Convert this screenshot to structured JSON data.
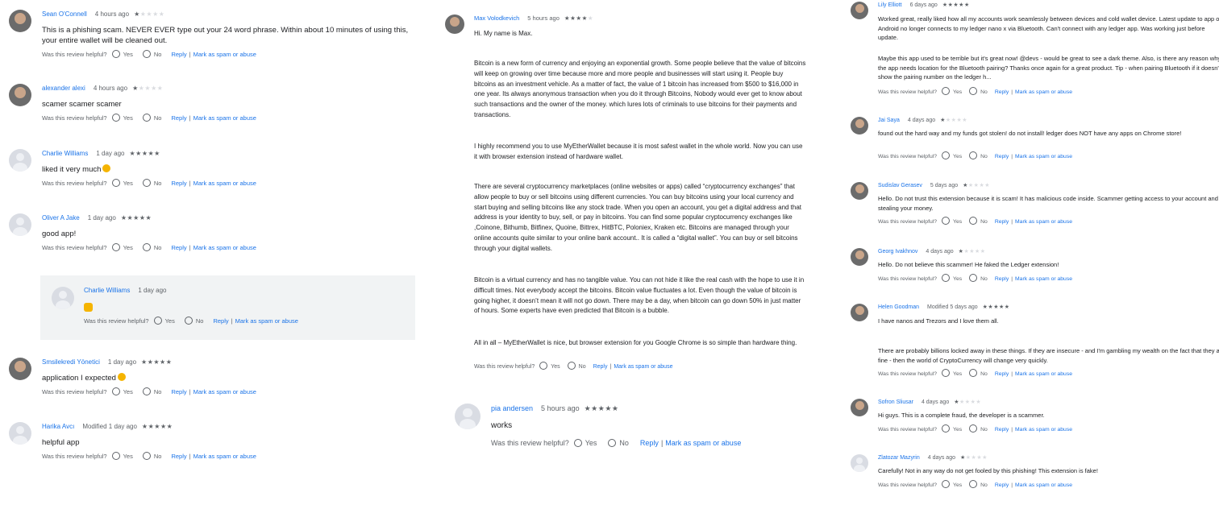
{
  "ui": {
    "helpful_q": "Was this review helpful?",
    "yes": "Yes",
    "no": "No",
    "reply": "Reply",
    "sep": "|",
    "spam": "Mark as spam or abuse"
  },
  "colors": {
    "link": "#1a73e8",
    "star_on": "#5f6368",
    "star_off": "#dadce0",
    "reply_bg": "#f1f3f4"
  },
  "col1": [
    {
      "author": "Sean O'Connell",
      "date": "4 hours ago",
      "rating": 1,
      "text": "This is a phishing scam. NEVER EVER type out your 24 word phrase. Within about 10 minutes of using this, your entire wallet will be cleaned out."
    },
    {
      "author": "alexander alexi",
      "date": "4 hours ago",
      "rating": 1,
      "text": "scamer scamer scamer"
    },
    {
      "author": "Charlie Williams",
      "date": "1 day ago",
      "rating": 5,
      "text": "liked it very much",
      "emoji": "smiling-face-sunglasses"
    },
    {
      "author": "Oliver A Jake",
      "date": "1 day ago",
      "rating": 5,
      "text": "good app!"
    },
    {
      "author": "Smsilekredi Yönetici",
      "date": "1 day ago",
      "rating": 5,
      "text": "application I expected",
      "emoji": "heart-eyes-face"
    },
    {
      "author": "Harika Avcı",
      "date": "Modified 1 day ago",
      "rating": 5,
      "text": "helpful app"
    }
  ],
  "col1_reply": {
    "author": "Charlie Williams",
    "date": "1 day ago",
    "emoji": "thumbs-up"
  },
  "col2": [
    {
      "author": "Max Volodkevich",
      "date": "5 hours ago",
      "rating": 4,
      "paras": [
        "Hi. My name is Max.",
        "Bitcoin is a new form of currency and enjoying an exponential growth. Some people believe that the value of bitcoins will keep on growing over time because more and more people and businesses will start using it. People buy bitcoins as an investment vehicle. As a matter of fact, the value of 1 bitcoin has increased from $500 to $16,000 in one year. Its always anonymous transaction when you do it through Bitcoins, Nobody would ever get to know about such transactions and the owner of the money. which lures lots of criminals to use bitcoins for their payments and transactions.",
        "I highly recommend you to use MyEtherWallet because it is most safest wallet in the whole world. Now you can use it with browser extension instead of hardware wallet.",
        "There are several cryptocurrency marketplaces (online websites or apps) called “cryptocurrency exchanges” that allow people to buy or sell bitcoins using different currencies. You can buy bitcoins using your local currency and start buying and selling bitcoins like any stock trade. When you open an account, you get a digital address and that address is your identity to buy, sell, or pay in bitcoins. You can find some popular cryptocurrency exchanges like ,Coinone, Bithumb, Bitfinex, Quoine, Bittrex, HitBTC, Poloniex, Kraken etc. Bitcoins are managed through your online accounts quite similar to your online bank account.. It is called a “digital wallet”. You can buy or sell bitcoins through your digital wallets.",
        "Bitcoin is a virtual currency and has no tangible value. You can not hide it like the real cash with the hope to use it in difficult times. Not everybody accept the bitcoins. Bitcoin value fluctuates a lot. Even though the value of bitcoin is going higher, it doesn’t mean it will not go down. There may be a day, when bitcoin can go down 50% in just matter of hours. Some experts have even predicted that Bitcoin is a bubble.",
        "All in all – MyEtherWallet is nice, but browser extension for you Google Chrome is so simple than hardware thing."
      ]
    },
    {
      "author": "pia andersen",
      "date": "5 hours ago",
      "rating": 5,
      "text": "works"
    }
  ],
  "col3": [
    {
      "author": "Lily Elliott",
      "date": "6 days ago",
      "rating": 5,
      "paras": [
        "Worked great, really liked how all my accounts work seamlessly between devices and cold wallet device. Latest update to app on Android no longer connects to my ledger nano x via Bluetooth. Can't connect with any ledger app. Was working just before update.",
        "Maybe this app used to be terrible but it's great now! @devs - would be great to see a dark theme. Also, is there any reason why the app needs location for the Bluetooth pairing? Thanks once again for a great product. Tip - when pairing Bluetooth if it doesn't show the pairing number on the ledger h..."
      ]
    },
    {
      "author": "Jai Saya",
      "date": "4 days ago",
      "rating": 1,
      "text": "found out the hard way and my funds got stolen! do not install! ledger does NOT have any apps on Chrome store!"
    },
    {
      "author": "Sudislav Gerasev",
      "date": "5 days ago",
      "rating": 1,
      "text": "Hello. Do not trust this extension because it is scam! It has malicious code inside. Scammer getting access to your account and stealing your money."
    },
    {
      "author": "Georg Ivakhnov",
      "date": "4 days ago",
      "rating": 1,
      "text": "Hello. Do not believe this scammer! He faked the Ledger extension!"
    },
    {
      "author": "Helen Goodman",
      "date": "Modified 5 days ago",
      "rating": 5,
      "paras": [
        "I have nanos and Trezors and I love them all.",
        "There are probably billions locked away in these things. If they are insecure - and I'm gambling my wealth on the fact that they are fine - then the world of CryptoCurrency will change very quickly."
      ]
    },
    {
      "author": "Sofron Sliusar",
      "date": "4 days ago",
      "rating": 1,
      "text": "Hi guys. This is a complete fraud, the developer is a scammer."
    },
    {
      "author": "Zlatozar Mazyrin",
      "date": "4 days ago",
      "rating": 1,
      "text": "Carefully! Not in any way do not get fooled by this phishing! This extension is fake!"
    }
  ]
}
